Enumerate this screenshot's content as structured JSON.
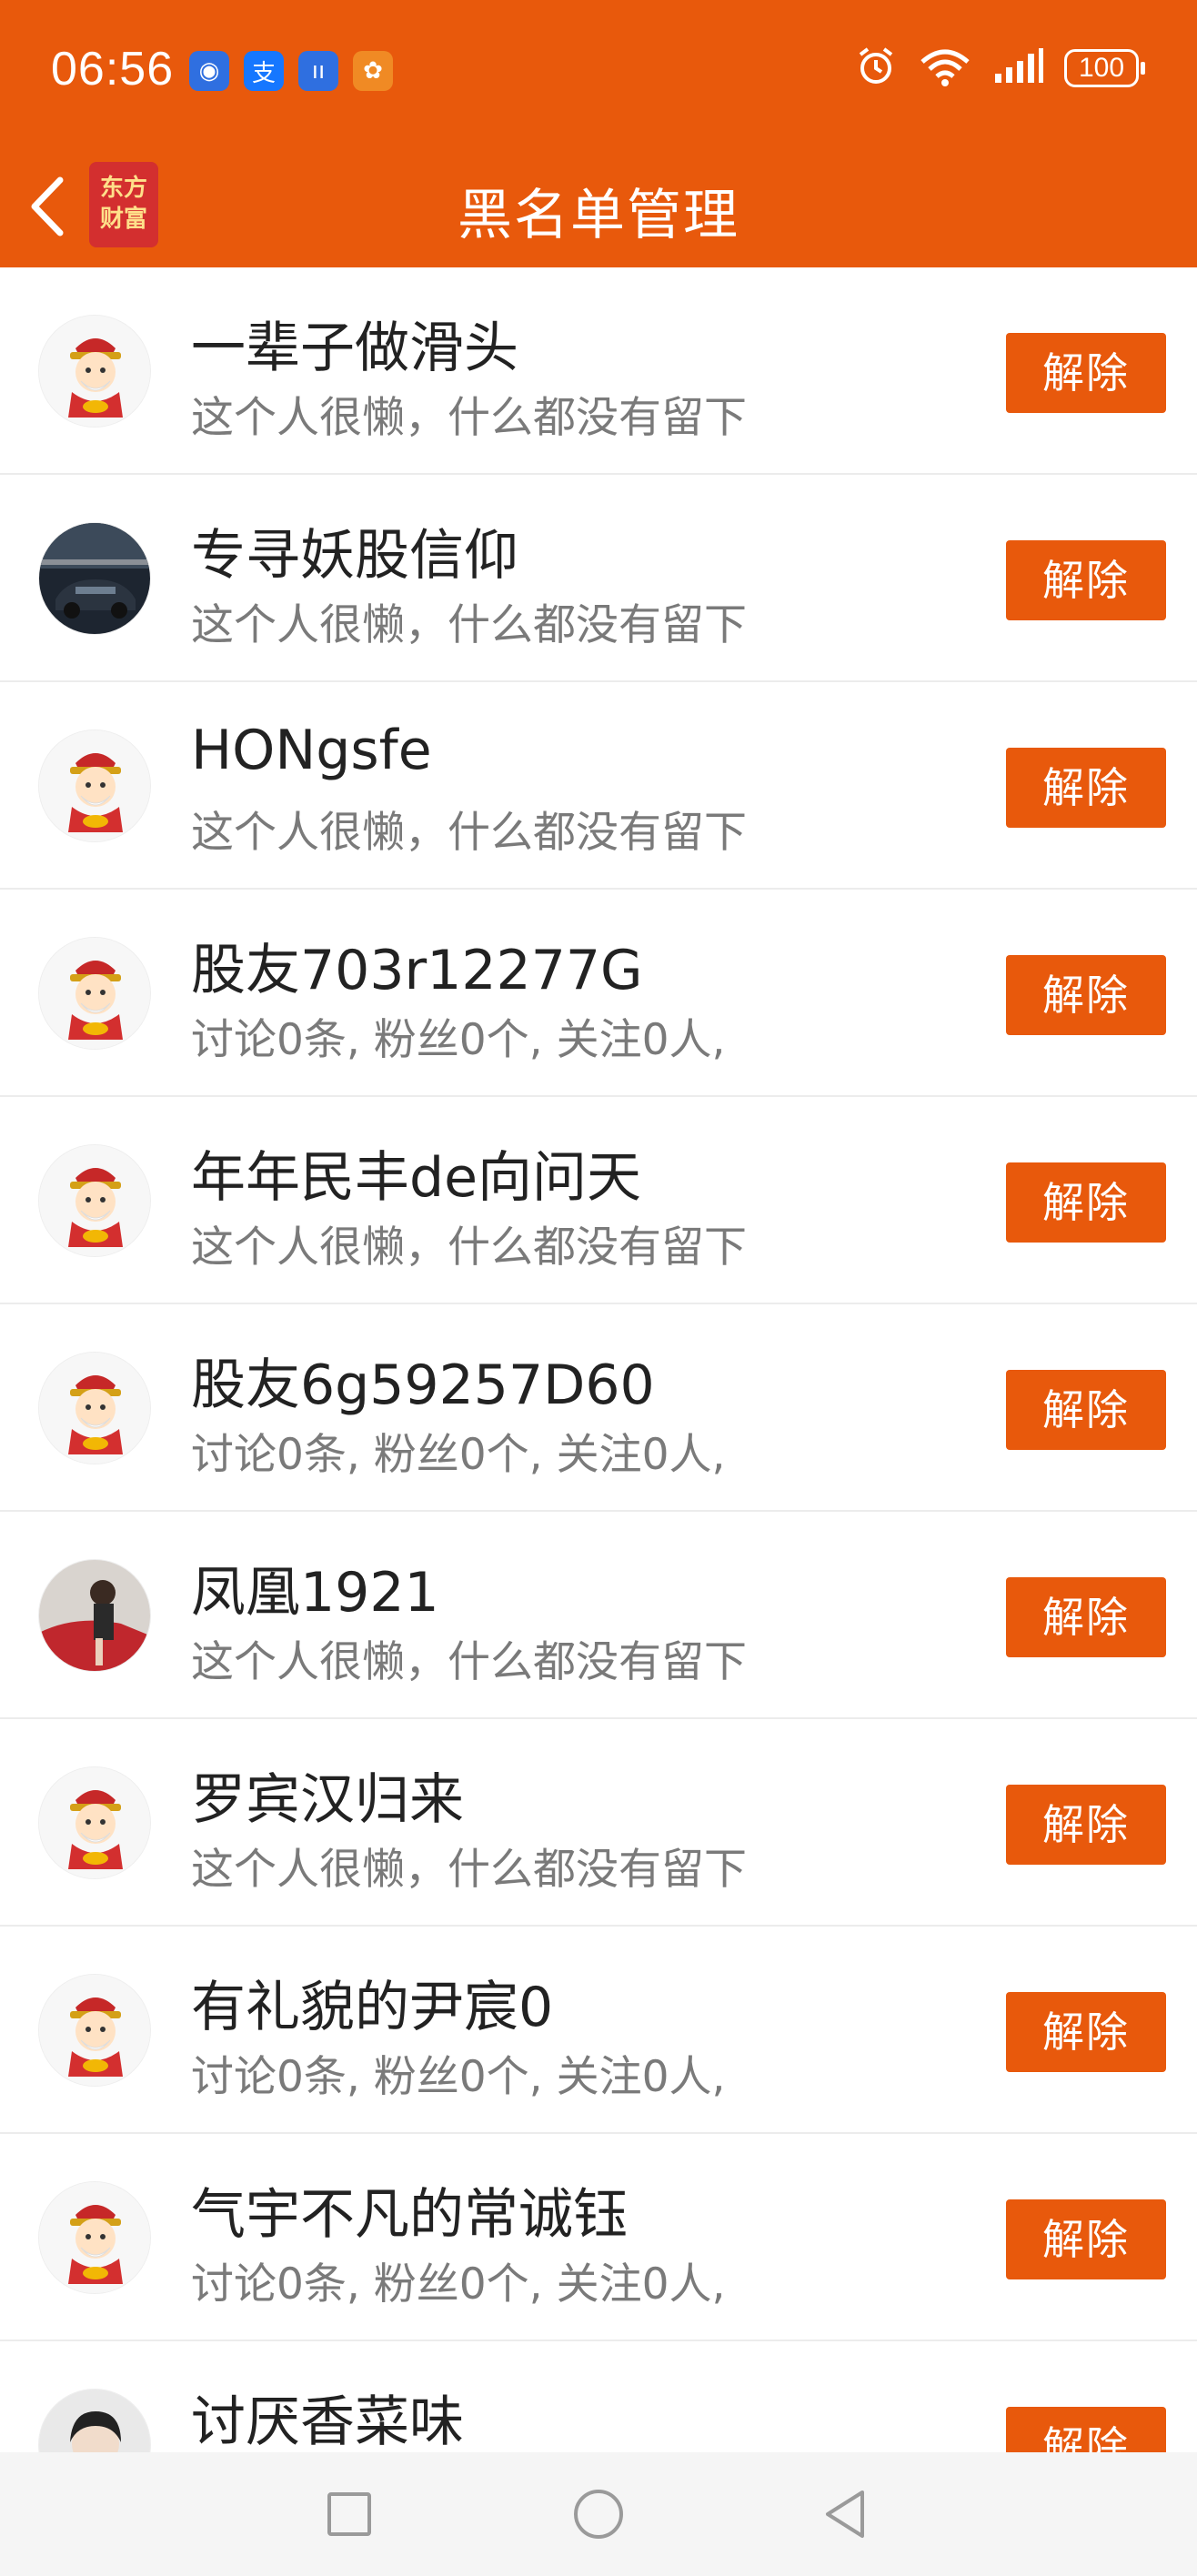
{
  "status_bar": {
    "time": "06:56",
    "notifications": [
      {
        "icon": "app-notification-icon",
        "color": "#2F6FE0",
        "glyph": "◉"
      },
      {
        "icon": "alipay-icon",
        "color": "#1677FF",
        "glyph": "支"
      },
      {
        "icon": "voice-app-icon",
        "color": "#2F6FE0",
        "glyph": "ıı"
      },
      {
        "icon": "fox-app-icon",
        "color": "#F08A24",
        "glyph": "✿"
      }
    ],
    "battery": "100"
  },
  "nav": {
    "title": "黑名单管理",
    "logo_text": "东方财富"
  },
  "colors": {
    "accent": "#E8590C"
  },
  "button_label": "解除",
  "items": [
    {
      "name": "一辈子做滑头",
      "desc": "这个人很懒，什么都没有留下",
      "avatar": "mascot"
    },
    {
      "name": "专寻妖股信仰",
      "desc": "这个人很懒，什么都没有留下",
      "avatar": "car"
    },
    {
      "name": "HONgsfe",
      "desc": "这个人很懒，什么都没有留下",
      "avatar": "mascot"
    },
    {
      "name": "股友703r12277G",
      "desc": "讨论0条, 粉丝0个, 关注0人,",
      "avatar": "mascot"
    },
    {
      "name": "年年民丰de向问天",
      "desc": "这个人很懒，什么都没有留下",
      "avatar": "mascot"
    },
    {
      "name": "股友6g59257D60",
      "desc": "讨论0条, 粉丝0个, 关注0人,",
      "avatar": "mascot"
    },
    {
      "name": "凤凰1921",
      "desc": "这个人很懒，什么都没有留下",
      "avatar": "person-car"
    },
    {
      "name": "罗宾汉归来",
      "desc": "这个人很懒，什么都没有留下",
      "avatar": "mascot"
    },
    {
      "name": "有礼貌的尹宸0",
      "desc": "讨论0条, 粉丝0个, 关注0人,",
      "avatar": "mascot"
    },
    {
      "name": "气宇不凡的常诚钰",
      "desc": "讨论0条, 粉丝0个, 关注0人,",
      "avatar": "mascot"
    },
    {
      "name": "讨厌香菜味",
      "desc": "",
      "avatar": "person"
    }
  ]
}
